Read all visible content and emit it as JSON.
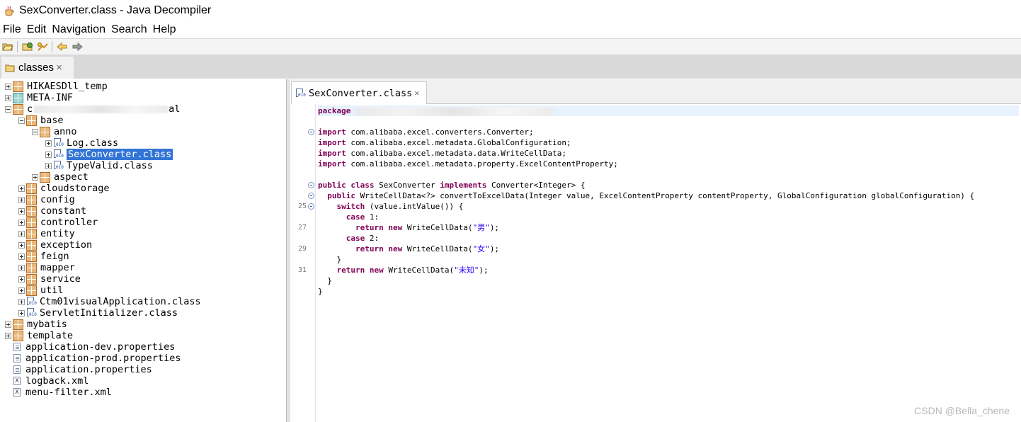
{
  "window": {
    "title": "SexConverter.class - Java Decompiler"
  },
  "menu": [
    "File",
    "Edit",
    "Navigation",
    "Search",
    "Help"
  ],
  "toolbar": {
    "buttons": [
      "open-file-icon",
      "open-type-icon",
      "reference-icon",
      "back-icon",
      "forward-icon"
    ]
  },
  "file_tab": {
    "label": "classes",
    "close": "✕"
  },
  "tree": [
    {
      "depth": 0,
      "expander": "plus",
      "icon": "package-brown",
      "label": "HIKAESDll_temp"
    },
    {
      "depth": 0,
      "expander": "plus",
      "icon": "package-teal",
      "label": "META-INF"
    },
    {
      "depth": 0,
      "expander": "minus",
      "icon": "package-brown",
      "label": "c",
      "suffix": "al",
      "blurred": true
    },
    {
      "depth": 1,
      "expander": "minus",
      "icon": "package-brown",
      "label": "base"
    },
    {
      "depth": 2,
      "expander": "minus",
      "icon": "package-brown",
      "label": "anno"
    },
    {
      "depth": 3,
      "expander": "plus",
      "icon": "class",
      "label": "Log.class"
    },
    {
      "depth": 3,
      "expander": "plus",
      "icon": "class",
      "label": "SexConverter.class",
      "selected": true
    },
    {
      "depth": 3,
      "expander": "plus",
      "icon": "class",
      "label": "TypeValid.class"
    },
    {
      "depth": 2,
      "expander": "plus",
      "icon": "package-brown",
      "label": "aspect"
    },
    {
      "depth": 1,
      "expander": "plus",
      "icon": "package-brown",
      "label": "cloudstorage"
    },
    {
      "depth": 1,
      "expander": "plus",
      "icon": "package-brown",
      "label": "config"
    },
    {
      "depth": 1,
      "expander": "plus",
      "icon": "package-brown",
      "label": "constant"
    },
    {
      "depth": 1,
      "expander": "plus",
      "icon": "package-brown",
      "label": "controller"
    },
    {
      "depth": 1,
      "expander": "plus",
      "icon": "package-brown",
      "label": "entity"
    },
    {
      "depth": 1,
      "expander": "plus",
      "icon": "package-brown",
      "label": "exception"
    },
    {
      "depth": 1,
      "expander": "plus",
      "icon": "package-brown",
      "label": "feign"
    },
    {
      "depth": 1,
      "expander": "plus",
      "icon": "package-brown",
      "label": "mapper"
    },
    {
      "depth": 1,
      "expander": "plus",
      "icon": "package-brown",
      "label": "service"
    },
    {
      "depth": 1,
      "expander": "plus",
      "icon": "package-brown",
      "label": "util"
    },
    {
      "depth": 1,
      "expander": "plus",
      "icon": "class",
      "label": "Ctm01visualApplication.class"
    },
    {
      "depth": 1,
      "expander": "plus",
      "icon": "class",
      "label": "ServletInitializer.class"
    },
    {
      "depth": 0,
      "expander": "plus",
      "icon": "package-brown",
      "label": "mybatis"
    },
    {
      "depth": 0,
      "expander": "plus",
      "icon": "package-brown",
      "label": "template"
    },
    {
      "depth": 0,
      "expander": "none",
      "icon": "file",
      "label": "application-dev.properties"
    },
    {
      "depth": 0,
      "expander": "none",
      "icon": "file",
      "label": "application-prod.properties"
    },
    {
      "depth": 0,
      "expander": "none",
      "icon": "file",
      "label": "application.properties"
    },
    {
      "depth": 0,
      "expander": "none",
      "icon": "xml",
      "label": "logback.xml"
    },
    {
      "depth": 0,
      "expander": "none",
      "icon": "xml",
      "label": "menu-filter.xml"
    }
  ],
  "editor_tab": {
    "label": "SexConverter.class",
    "close": "✕"
  },
  "code": [
    {
      "ln": "",
      "fold": false,
      "highlight": true,
      "parts": [
        [
          "kw",
          "package"
        ],
        [
          "txt",
          " "
        ]
      ],
      "blur": true
    },
    {
      "ln": "",
      "fold": false,
      "parts": []
    },
    {
      "ln": "",
      "fold": true,
      "parts": [
        [
          "kw",
          "import"
        ],
        [
          "txt",
          " com.alibaba.excel.converters.Converter;"
        ]
      ]
    },
    {
      "ln": "",
      "fold": false,
      "parts": [
        [
          "kw",
          "import"
        ],
        [
          "txt",
          " com.alibaba.excel.metadata.GlobalConfiguration;"
        ]
      ]
    },
    {
      "ln": "",
      "fold": false,
      "parts": [
        [
          "kw",
          "import"
        ],
        [
          "txt",
          " com.alibaba.excel.metadata.data.WriteCellData;"
        ]
      ]
    },
    {
      "ln": "",
      "fold": false,
      "parts": [
        [
          "kw",
          "import"
        ],
        [
          "txt",
          " com.alibaba.excel.metadata.property.ExcelContentProperty;"
        ]
      ]
    },
    {
      "ln": "",
      "fold": false,
      "parts": []
    },
    {
      "ln": "",
      "fold": true,
      "parts": [
        [
          "kw",
          "public class"
        ],
        [
          "txt",
          " SexConverter "
        ],
        [
          "kw",
          "implements"
        ],
        [
          "txt",
          " Converter<Integer> {"
        ]
      ]
    },
    {
      "ln": "",
      "fold": true,
      "parts": [
        [
          "txt",
          "  "
        ],
        [
          "kw",
          "public"
        ],
        [
          "txt",
          " WriteCellData<?> convertToExcelData(Integer value, ExcelContentProperty contentProperty, GlobalConfiguration globalConfiguration) {"
        ]
      ]
    },
    {
      "ln": "25",
      "fold": true,
      "parts": [
        [
          "txt",
          "    "
        ],
        [
          "kw",
          "switch"
        ],
        [
          "txt",
          " (value.intValue()) {"
        ]
      ]
    },
    {
      "ln": "",
      "fold": false,
      "parts": [
        [
          "txt",
          "      "
        ],
        [
          "kw",
          "case"
        ],
        [
          "txt",
          " 1:"
        ]
      ]
    },
    {
      "ln": "27",
      "fold": false,
      "parts": [
        [
          "txt",
          "        "
        ],
        [
          "kw",
          "return new"
        ],
        [
          "txt",
          " WriteCellData("
        ],
        [
          "str",
          "\"男\""
        ],
        [
          "txt",
          ");"
        ]
      ]
    },
    {
      "ln": "",
      "fold": false,
      "parts": [
        [
          "txt",
          "      "
        ],
        [
          "kw",
          "case"
        ],
        [
          "txt",
          " 2:"
        ]
      ]
    },
    {
      "ln": "29",
      "fold": false,
      "parts": [
        [
          "txt",
          "        "
        ],
        [
          "kw",
          "return new"
        ],
        [
          "txt",
          " WriteCellData("
        ],
        [
          "str",
          "\"女\""
        ],
        [
          "txt",
          ");"
        ]
      ]
    },
    {
      "ln": "",
      "fold": false,
      "parts": [
        [
          "txt",
          "    }"
        ]
      ]
    },
    {
      "ln": "31",
      "fold": false,
      "parts": [
        [
          "txt",
          "    "
        ],
        [
          "kw",
          "return new"
        ],
        [
          "txt",
          " WriteCellData("
        ],
        [
          "str",
          "\"未知\""
        ],
        [
          "txt",
          ");"
        ]
      ]
    },
    {
      "ln": "",
      "fold": false,
      "parts": [
        [
          "txt",
          "  }"
        ]
      ]
    },
    {
      "ln": "",
      "fold": false,
      "parts": [
        [
          "txt",
          "}"
        ]
      ]
    }
  ],
  "watermark": "CSDN @Bella_chene"
}
